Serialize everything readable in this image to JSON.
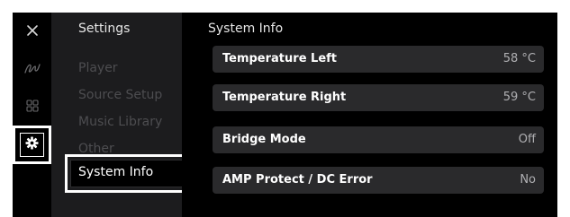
{
  "rail": {
    "icons": [
      "close-icon",
      "signature-icon",
      "grid-icon",
      "gear-icon"
    ]
  },
  "menu": {
    "title": "Settings",
    "items": [
      {
        "label": "Player"
      },
      {
        "label": "Source Setup"
      },
      {
        "label": "Music Library"
      },
      {
        "label": "Other"
      },
      {
        "label": "System Info",
        "selected": true
      }
    ]
  },
  "main": {
    "title": "System Info",
    "rows": [
      {
        "label": "Temperature Left",
        "value": "58 °C"
      },
      {
        "label": "Temperature Right",
        "value": "59 °C"
      },
      {
        "label": "Bridge Mode",
        "value": "Off"
      },
      {
        "label": "AMP Protect / DC Error",
        "value": "No"
      }
    ]
  },
  "colors": {
    "background": "#000000",
    "menu_panel": "#1c1c1e",
    "row_background": "#2a2a2c",
    "dim_text": "#4d4d50",
    "highlight": "#ffffff"
  }
}
